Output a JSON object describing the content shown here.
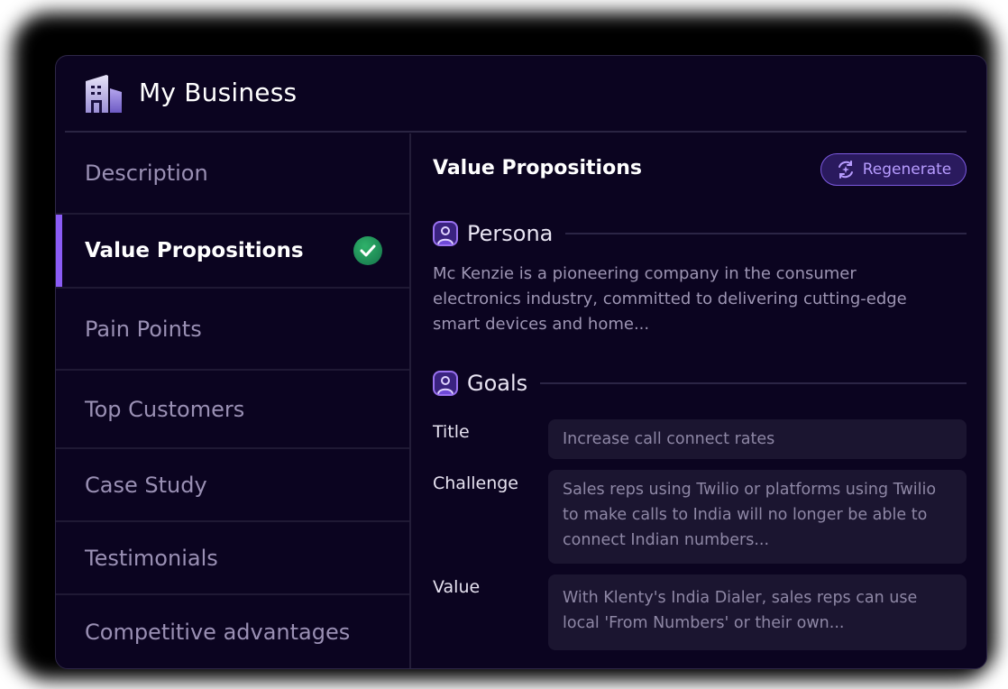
{
  "header": {
    "title": "My Business",
    "icon": "building-icon"
  },
  "sidebar": {
    "items": [
      {
        "label": "Description",
        "active": false
      },
      {
        "label": "Value Propositions",
        "active": true,
        "status": "check-circle-icon"
      },
      {
        "label": "Pain Points",
        "active": false
      },
      {
        "label": "Top Customers",
        "active": false
      },
      {
        "label": "Case Study",
        "active": false
      },
      {
        "label": "Testimonials",
        "active": false
      },
      {
        "label": "Competitive advantages",
        "active": false
      }
    ]
  },
  "main": {
    "title": "Value Propositions",
    "regenerate_label": "Regenerate",
    "persona": {
      "heading": "Persona",
      "text": "Mc Kenzie is a pioneering company in the consumer electronics industry, committed to delivering cutting-edge smart devices and home..."
    },
    "goals": {
      "heading": "Goals",
      "fields": [
        {
          "label": "Title",
          "value": "Increase call connect rates"
        },
        {
          "label": "Challenge",
          "value": "Sales reps using Twilio or platforms using Twilio to make calls to India will no longer be able to connect Indian numbers..."
        },
        {
          "label": "Value",
          "value": "With Klenty's India Dialer, sales reps can use local 'From Numbers' or their own..."
        }
      ]
    }
  },
  "colors": {
    "accent": "#8b5cf6",
    "background": "#0b0420",
    "success": "#1f9a5b"
  }
}
